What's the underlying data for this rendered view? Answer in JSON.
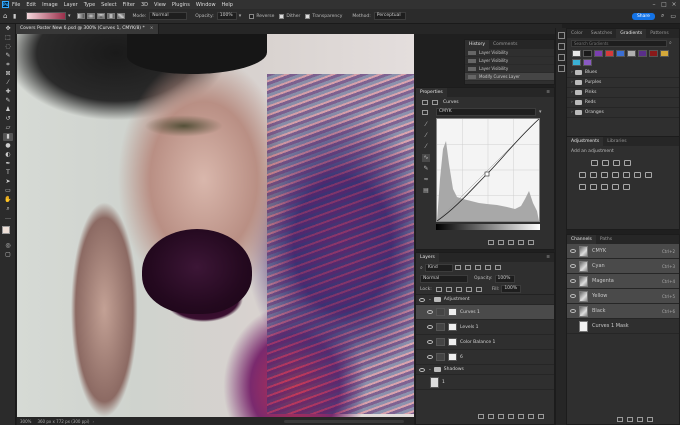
{
  "menubar": {
    "items": [
      "File",
      "Edit",
      "Image",
      "Layer",
      "Type",
      "Select",
      "Filter",
      "3D",
      "View",
      "Plugins",
      "Window",
      "Help"
    ]
  },
  "options": {
    "mode_label": "Mode:",
    "mode_value": "Normal",
    "opacity_label": "Opacity:",
    "opacity_value": "100%",
    "reverse_label": "Reverse",
    "dither_label": "Dither",
    "transparency_label": "Transparency",
    "method_label": "Method:",
    "method_value": "Perceptual",
    "share_label": "Share"
  },
  "document": {
    "tab_title": "Covers Poster New 6.psd @ 300% (Curves 1, CMYK/8) *"
  },
  "status": {
    "zoom": "300%",
    "size": "360 px x 772 px (300 ppi)"
  },
  "history": {
    "tabs": [
      "History",
      "Comments"
    ],
    "items": [
      "Layer Visibility",
      "Layer Visibility",
      "Layer Visibility",
      "Modify Curves Layer"
    ]
  },
  "properties": {
    "title": "Properties",
    "type": "Curves",
    "preset": "CMYK"
  },
  "layers": {
    "title": "Layers",
    "filter": "Kind",
    "blend": "Normal",
    "opacity_label": "Opacity:",
    "opacity": "100%",
    "lock_label": "Lock:",
    "fill_label": "Fill:",
    "fill": "100%",
    "rows": [
      {
        "name": "Adjustment",
        "kind": "group"
      },
      {
        "name": "Curves 1",
        "kind": "adj"
      },
      {
        "name": "Levels 1",
        "kind": "adj"
      },
      {
        "name": "Color Balance 1",
        "kind": "adj"
      },
      {
        "name": "6",
        "kind": "adj"
      },
      {
        "name": "Shadows",
        "kind": "group"
      },
      {
        "name": "1",
        "kind": "pixel"
      }
    ]
  },
  "swatches": {
    "tabs": [
      "Color",
      "Swatches",
      "Gradients",
      "Patterns"
    ],
    "search_placeholder": "Search Gradients",
    "folders": [
      "Blues",
      "Purples",
      "Pinks",
      "Reds",
      "Oranges"
    ],
    "gradient_colors": [
      "#e8e8e8",
      "#1a1a1a",
      "#7b3fb0",
      "#d43a3a",
      "#3b6fd4",
      "#b0b0b0",
      "#5a2e8a",
      "#8a1a1a",
      "#d4a83a",
      "#3ab0d4",
      "#8a5ac4"
    ]
  },
  "adjustments": {
    "tabs": [
      "Adjustments",
      "Libraries"
    ],
    "hint": "Add an adjustment"
  },
  "channels": {
    "tabs": [
      "Channels",
      "Paths"
    ],
    "rows": [
      {
        "name": "CMYK",
        "key": "Ctrl+2"
      },
      {
        "name": "Cyan",
        "key": "Ctrl+3"
      },
      {
        "name": "Magenta",
        "key": "Ctrl+4"
      },
      {
        "name": "Yellow",
        "key": "Ctrl+5"
      },
      {
        "name": "Black",
        "key": "Ctrl+6"
      },
      {
        "name": "Curves 1 Mask",
        "key": ""
      }
    ]
  }
}
